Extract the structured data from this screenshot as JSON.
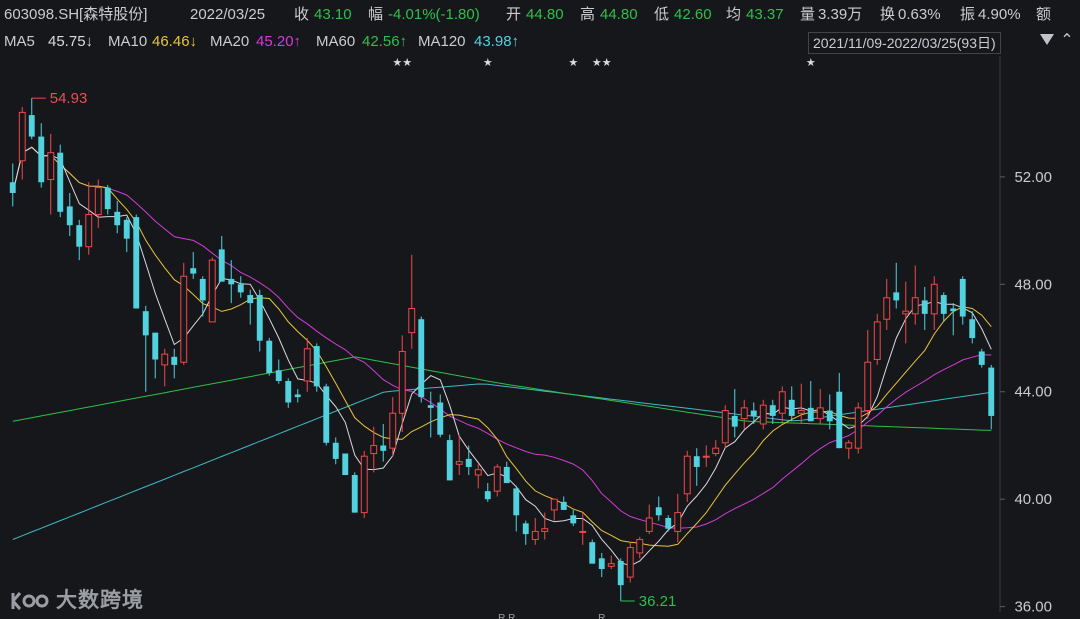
{
  "header": {
    "code": "603098.SH[森特股份]",
    "date": "2022/03/25",
    "close_label": "收",
    "close_value": "43.10",
    "change_label": "幅",
    "change_value": "-4.01%(-1.80)",
    "open_label": "开",
    "open_value": "44.80",
    "high_label": "高",
    "high_value": "44.80",
    "low_label": "低",
    "low_value": "42.60",
    "avg_label": "均",
    "avg_value": "43.37",
    "volume_label": "量",
    "volume_value": "3.39万",
    "turnover_label": "换",
    "turnover_value": "0.63%",
    "amplitude_label": "振",
    "amplitude_value": "4.90%",
    "amount_label": "额"
  },
  "indicators": {
    "ma5_label": "MA5",
    "ma5_value": "45.75↓",
    "ma10_label": "MA10",
    "ma10_value": "46.46↓",
    "ma20_label": "MA20",
    "ma20_value": "45.20↑",
    "ma60_label": "MA60",
    "ma60_value": "42.56↑",
    "ma120_label": "MA120",
    "ma120_value": "43.98↑",
    "range": "2021/11/09-2022/03/25(93日)"
  },
  "colors": {
    "background": "#16171b",
    "candle_up": "#f04848",
    "candle_down": "#52d2de",
    "ma5": "#d8dadf",
    "ma10": "#e8c53a",
    "ma20": "#d23bd8",
    "ma60": "#2fbf4a",
    "ma120": "#3fb8c4"
  },
  "chart_data": {
    "type": "candlestick",
    "ylim": [
      35.8,
      56.5
    ],
    "y_ticks": [
      "52.00",
      "48.00",
      "44.00",
      "40.00",
      "36.00"
    ],
    "y_tick_values": [
      52,
      48,
      44,
      40,
      36
    ],
    "max_label": "54.93",
    "max_value": 54.93,
    "max_index": 2,
    "min_label": "36.21",
    "min_value": 36.21,
    "min_index": 64,
    "event_markers": [
      {
        "index": 41,
        "symbol": "★★"
      },
      {
        "index": 50,
        "symbol": "★"
      },
      {
        "index": 59,
        "symbol": "★"
      },
      {
        "index": 62,
        "symbol": "★★"
      },
      {
        "index": 84,
        "symbol": "★"
      }
    ],
    "bottom_markers": [
      {
        "index": 52,
        "symbol": "R R"
      },
      {
        "index": 62,
        "symbol": "R"
      }
    ],
    "candles": [
      [
        51.8,
        52.5,
        50.9,
        51.4
      ],
      [
        52.6,
        54.6,
        51.9,
        54.4
      ],
      [
        54.3,
        54.93,
        53.4,
        53.5
      ],
      [
        53.5,
        54.0,
        51.6,
        51.8
      ],
      [
        51.9,
        53.6,
        50.6,
        52.9
      ],
      [
        52.9,
        53.2,
        50.5,
        50.7
      ],
      [
        50.9,
        51.4,
        49.8,
        50.2
      ],
      [
        50.2,
        50.4,
        48.9,
        49.4
      ],
      [
        49.4,
        51.8,
        49.1,
        50.6
      ],
      [
        50.6,
        51.9,
        50.1,
        51.6
      ],
      [
        51.6,
        51.7,
        50.6,
        50.8
      ],
      [
        50.7,
        51.1,
        49.9,
        50.2
      ],
      [
        50.4,
        50.5,
        49.2,
        49.7
      ],
      [
        50.5,
        50.6,
        47.1,
        47.1
      ],
      [
        47.0,
        47.2,
        44.0,
        46.1
      ],
      [
        46.2,
        46.2,
        44.5,
        45.2
      ],
      [
        45.0,
        45.6,
        44.2,
        45.4
      ],
      [
        45.3,
        45.6,
        44.5,
        45.0
      ],
      [
        45.1,
        48.8,
        45.0,
        48.3
      ],
      [
        48.6,
        49.2,
        48.2,
        48.4
      ],
      [
        48.2,
        48.3,
        46.8,
        47.4
      ],
      [
        46.6,
        49.0,
        46.6,
        48.9
      ],
      [
        49.3,
        49.8,
        48.1,
        48.1
      ],
      [
        48.2,
        48.9,
        47.3,
        48.0
      ],
      [
        48.0,
        48.3,
        47.5,
        47.7
      ],
      [
        47.6,
        47.8,
        46.5,
        47.3
      ],
      [
        47.6,
        47.8,
        45.5,
        45.9
      ],
      [
        45.9,
        46.0,
        44.6,
        44.7
      ],
      [
        44.8,
        45.2,
        44.3,
        44.4
      ],
      [
        44.4,
        44.5,
        43.4,
        43.6
      ],
      [
        43.9,
        44.1,
        43.6,
        43.8
      ],
      [
        44.4,
        46.0,
        44.0,
        45.6
      ],
      [
        45.7,
        45.8,
        44.0,
        44.2
      ],
      [
        44.2,
        44.3,
        42.0,
        42.1
      ],
      [
        42.1,
        42.3,
        41.3,
        41.5
      ],
      [
        41.7,
        41.7,
        40.9,
        40.9
      ],
      [
        40.9,
        41.0,
        39.5,
        39.5
      ],
      [
        39.5,
        41.8,
        39.3,
        41.6
      ],
      [
        41.7,
        42.7,
        41.0,
        42.0
      ],
      [
        42.0,
        42.8,
        41.4,
        41.8
      ],
      [
        41.9,
        43.8,
        41.6,
        43.2
      ],
      [
        43.2,
        46.1,
        42.5,
        45.5
      ],
      [
        46.2,
        49.1,
        45.6,
        47.1
      ],
      [
        46.7,
        46.8,
        43.6,
        43.8
      ],
      [
        43.5,
        44.0,
        42.3,
        43.4
      ],
      [
        43.6,
        43.9,
        42.3,
        42.4
      ],
      [
        42.2,
        42.4,
        40.7,
        40.7
      ],
      [
        41.3,
        42.4,
        40.9,
        41.4
      ],
      [
        41.5,
        42.0,
        40.9,
        41.2
      ],
      [
        40.9,
        41.3,
        40.4,
        41.1
      ],
      [
        40.3,
        40.6,
        39.9,
        40.0
      ],
      [
        40.3,
        41.3,
        40.1,
        41.2
      ],
      [
        41.2,
        41.4,
        40.6,
        40.6
      ],
      [
        40.4,
        40.5,
        38.8,
        39.4
      ],
      [
        39.1,
        39.2,
        38.3,
        38.7
      ],
      [
        38.5,
        39.3,
        38.3,
        38.8
      ],
      [
        38.8,
        39.5,
        38.5,
        38.9
      ],
      [
        39.6,
        40.0,
        39.2,
        40.0
      ],
      [
        39.9,
        40.1,
        39.6,
        39.6
      ],
      [
        39.4,
        39.6,
        39.0,
        39.1
      ],
      [
        38.8,
        39.5,
        38.3,
        38.8
      ],
      [
        38.4,
        38.5,
        37.6,
        37.6
      ],
      [
        37.8,
        38.0,
        37.1,
        37.4
      ],
      [
        37.5,
        37.9,
        37.4,
        37.6
      ],
      [
        37.7,
        37.8,
        36.21,
        36.8
      ],
      [
        37.1,
        38.4,
        36.9,
        38.2
      ],
      [
        38.0,
        38.6,
        37.8,
        38.5
      ],
      [
        38.8,
        39.8,
        38.7,
        39.3
      ],
      [
        39.7,
        40.1,
        39.2,
        39.4
      ],
      [
        39.3,
        39.4,
        38.8,
        38.9
      ],
      [
        38.8,
        40.2,
        38.4,
        39.5
      ],
      [
        40.2,
        41.8,
        39.9,
        41.6
      ],
      [
        41.6,
        41.9,
        40.5,
        41.2
      ],
      [
        41.6,
        42.0,
        41.2,
        41.6
      ],
      [
        41.7,
        42.2,
        41.6,
        41.9
      ],
      [
        42.1,
        43.5,
        41.9,
        43.3
      ],
      [
        43.1,
        44.1,
        42.3,
        42.7
      ],
      [
        43.0,
        43.7,
        42.6,
        43.4
      ],
      [
        43.3,
        43.6,
        42.8,
        43.1
      ],
      [
        42.8,
        43.7,
        42.6,
        43.5
      ],
      [
        43.5,
        43.7,
        42.8,
        43.1
      ],
      [
        43.2,
        44.2,
        42.8,
        44.0
      ],
      [
        43.7,
        44.2,
        42.9,
        43.1
      ],
      [
        43.2,
        44.3,
        42.8,
        43.3
      ],
      [
        43.4,
        44.4,
        42.9,
        42.9
      ],
      [
        43.0,
        44.1,
        42.8,
        43.4
      ],
      [
        43.3,
        43.9,
        42.6,
        42.9
      ],
      [
        44.0,
        44.7,
        41.9,
        41.9
      ],
      [
        41.9,
        42.2,
        41.5,
        42.1
      ],
      [
        41.9,
        43.6,
        41.7,
        43.4
      ],
      [
        43.3,
        46.3,
        43.0,
        45.1
      ],
      [
        45.2,
        46.9,
        45.0,
        46.6
      ],
      [
        46.7,
        48.2,
        46.3,
        47.5
      ],
      [
        47.7,
        48.8,
        47.1,
        47.4
      ],
      [
        46.9,
        48.1,
        45.8,
        47.0
      ],
      [
        46.9,
        48.7,
        46.5,
        47.5
      ],
      [
        47.4,
        47.9,
        46.3,
        46.9
      ],
      [
        46.9,
        48.3,
        46.3,
        48.0
      ],
      [
        47.6,
        47.7,
        46.6,
        46.9
      ],
      [
        47.1,
        47.3,
        46.1,
        47.0
      ],
      [
        48.2,
        48.3,
        46.5,
        46.8
      ],
      [
        46.7,
        47.0,
        45.8,
        46.0
      ],
      [
        45.5,
        45.6,
        44.9,
        45.0
      ],
      [
        44.9,
        45.0,
        42.6,
        43.1
      ]
    ]
  },
  "watermark": {
    "text": "大数跨境"
  }
}
